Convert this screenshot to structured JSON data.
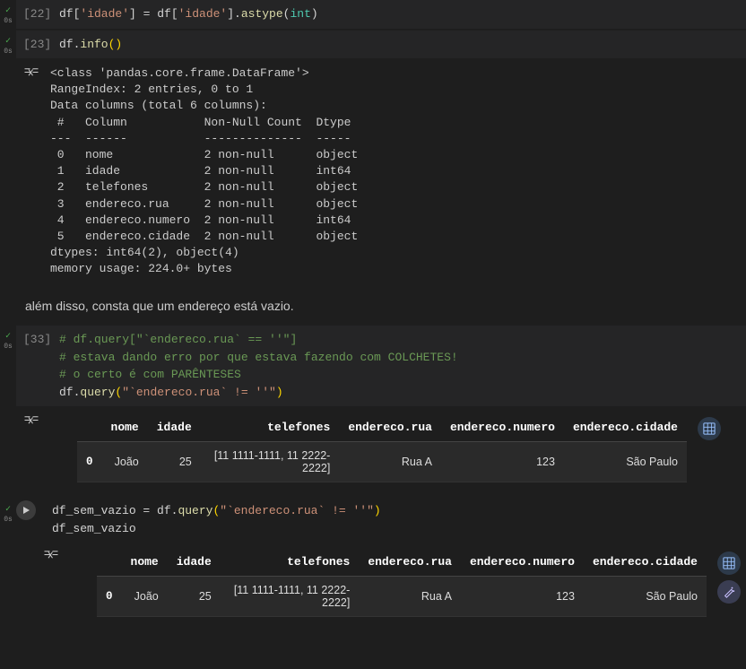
{
  "cells": {
    "c22": {
      "prompt": "[22]",
      "time": "0s",
      "code_tokens": "df['idade'] = df['idade'].astype(int)"
    },
    "c23": {
      "prompt": "[23]",
      "time": "0s",
      "code_tokens": "df.info()",
      "output": "<class 'pandas.core.frame.DataFrame'>\nRangeIndex: 2 entries, 0 to 1\nData columns (total 6 columns):\n #   Column           Non-Null Count  Dtype \n---  ------           --------------  ----- \n 0   nome             2 non-null      object\n 1   idade            2 non-null      int64 \n 2   telefones        2 non-null      object\n 3   endereco.rua     2 non-null      object\n 4   endereco.numero  2 non-null      int64 \n 5   endereco.cidade  2 non-null      object\ndtypes: int64(2), object(4)\nmemory usage: 224.0+ bytes"
    },
    "md1": {
      "text": "além disso, consta que um endereço está vazio."
    },
    "c33": {
      "prompt": "[33]",
      "time": "0s",
      "comments": [
        "# df.query[\"`endereco.rua` == ''\"]",
        "# estava dando erro por que estava fazendo com COLCHETES!",
        "# o certo é com PARÊNTESES"
      ],
      "code_text": "df.query(\"`endereco.rua` != ''\")"
    },
    "c_last": {
      "time": "0s",
      "line1": "df_sem_vazio = df.query(\"`endereco.rua` != ''\")",
      "line2": "df_sem_vazio"
    }
  },
  "table": {
    "headers": [
      "",
      "nome",
      "idade",
      "telefones",
      "endereco.rua",
      "endereco.numero",
      "endereco.cidade"
    ],
    "rows": [
      {
        "idx": "0",
        "nome": "João",
        "idade": "25",
        "telefones": "[11 1111-1111, 11 2222-2222]",
        "rua": "Rua A",
        "numero": "123",
        "cidade": "São Paulo"
      }
    ]
  }
}
